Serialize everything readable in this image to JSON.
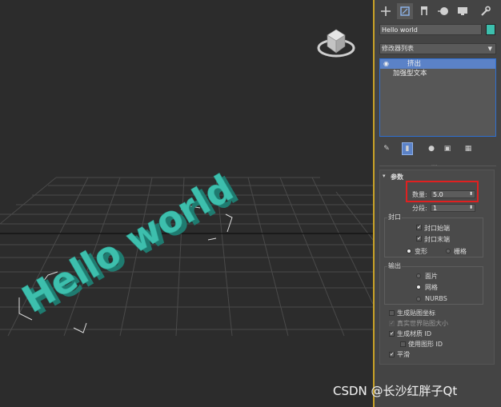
{
  "viewport": {
    "scene_text": "Hello world",
    "text_color": "#3dbfad",
    "grid_color": "#444444",
    "bg_color": "#2c2c2c"
  },
  "toolbar": {
    "icons": [
      "create-icon",
      "modify-icon",
      "hierarchy-icon",
      "motion-icon",
      "display-icon",
      "utilities-icon"
    ]
  },
  "object": {
    "name": "Hello world",
    "color": "#3dbfad"
  },
  "modifier_list": {
    "label": "修改器列表"
  },
  "stack": {
    "items": [
      {
        "label": "挤出",
        "selected": true
      },
      {
        "label": "加强型文本",
        "selected": false
      }
    ]
  },
  "params": {
    "title": "参数",
    "amount_label": "数量:",
    "amount_value": "5.0",
    "segments_label": "分段:",
    "segments_value": "1",
    "capping": {
      "label": "封口",
      "cap_start": "封口始端",
      "cap_end": "封口末端",
      "morph": "变形",
      "grid": "栅格"
    },
    "output": {
      "label": "输出",
      "patch": "面片",
      "mesh": "网格",
      "nurbs": "NURBS"
    },
    "gen_mapping": "生成贴图坐标",
    "real_world": "真实世界贴图大小",
    "gen_mat_ids": "生成材质 ID",
    "use_shape_ids": "使用图形 ID",
    "smooth": "平滑"
  },
  "watermark": {
    "text": "CSDN @长沙红胖子Qt"
  }
}
